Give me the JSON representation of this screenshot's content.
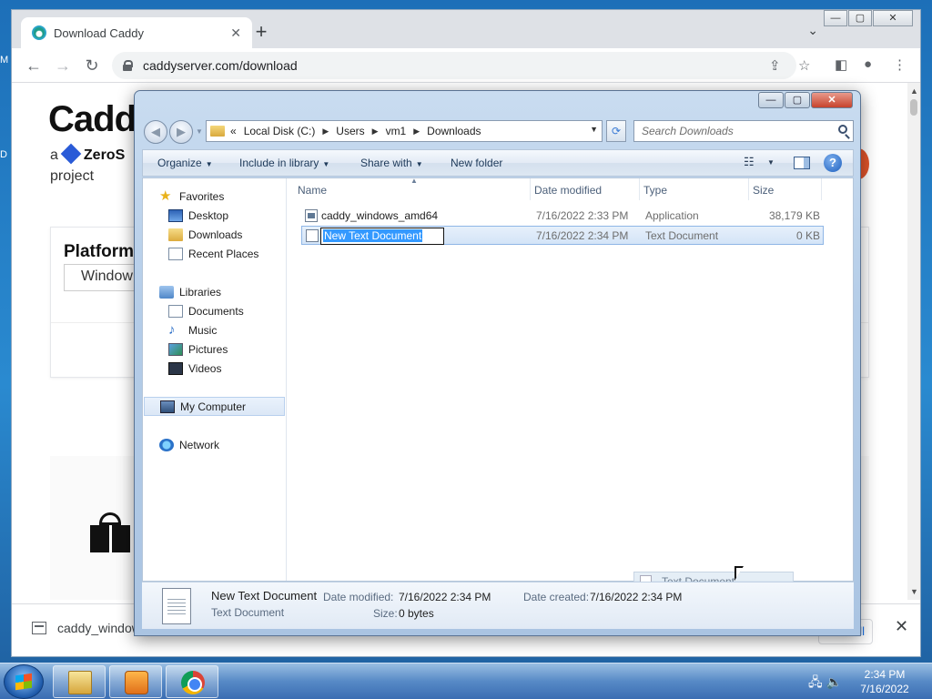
{
  "browser": {
    "tab_title": "Download Caddy",
    "tab_close": "✕",
    "new_tab": "+",
    "tab_search": "⌄",
    "win_min": "—",
    "win_max": "▢",
    "win_close": "✕",
    "back": "←",
    "forward": "→",
    "reload": "↻",
    "url": "caddyserver.com/download",
    "share": "⇪",
    "star": "☆",
    "sidepanel": "◧",
    "profile": "●",
    "menu": "⋮"
  },
  "page": {
    "logo": "Cadd",
    "byline_prefix": "a",
    "byline_brand": "ZeroS",
    "byline_suffix": "project",
    "platform_heading": "Platform",
    "platform_value": "Window"
  },
  "downloads_bar": {
    "file": "caddy_window",
    "show_all": "all",
    "close": "✕"
  },
  "desktop": {
    "frag_m": "M",
    "frag_d": "D"
  },
  "explorer": {
    "caption": {
      "min": "—",
      "max": "▢",
      "close": "✕"
    },
    "nav": {
      "back": "◀",
      "forward": "▶",
      "dropdown": "▼"
    },
    "address": {
      "lead": "«",
      "crumbs": [
        "Local Disk (C:)",
        "Users",
        "vm1",
        "Downloads"
      ],
      "sep": "▶",
      "dropdown": "▼"
    },
    "refresh": "⟳",
    "search_placeholder": "Search Downloads",
    "commands": {
      "organize": "Organize",
      "include": "Include in library",
      "share": "Share with",
      "new_folder": "New folder",
      "caret": "▼",
      "views": "☷",
      "help": "?"
    },
    "navpane": {
      "favorites": "Favorites",
      "desktop": "Desktop",
      "downloads": "Downloads",
      "recent": "Recent Places",
      "libraries": "Libraries",
      "documents": "Documents",
      "music": "Music",
      "pictures": "Pictures",
      "videos": "Videos",
      "computer": "My Computer",
      "network": "Network"
    },
    "columns": {
      "name": "Name",
      "date": "Date modified",
      "type": "Type",
      "size": "Size",
      "sort": "▲"
    },
    "files": [
      {
        "name": "caddy_windows_amd64",
        "date": "7/16/2022 2:33 PM",
        "type": "Application",
        "size": "38,179 KB"
      },
      {
        "name": "New Text Document",
        "date": "7/16/2022 2:34 PM",
        "type": "Text Document",
        "size": "0 KB"
      }
    ],
    "drag_ghost": "Text Document",
    "details": {
      "name": "New Text Document",
      "type": "Text Document",
      "modified_label": "Date modified:",
      "modified": "7/16/2022 2:34 PM",
      "created_label": "Date created:",
      "created": "7/16/2022 2:34 PM",
      "size_label": "Size:",
      "size": "0 bytes"
    }
  },
  "taskbar": {
    "tray_icons": "🖧 🔈",
    "time": "2:34 PM",
    "date": "7/16/2022"
  }
}
